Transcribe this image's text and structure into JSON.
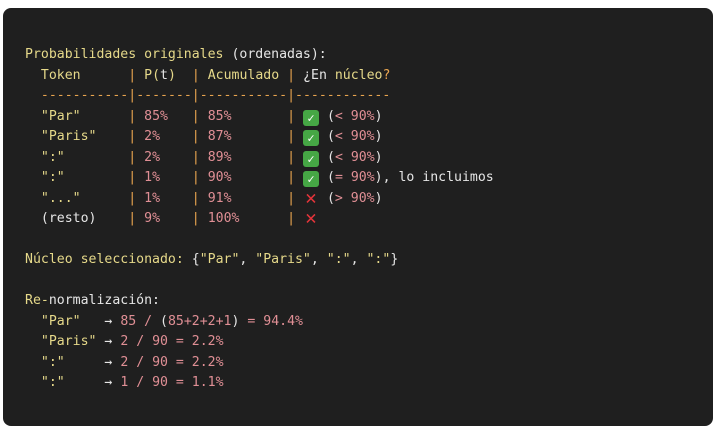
{
  "header": {
    "title": "Probabilidades originales",
    "qualifier": "(ordenadas):"
  },
  "table": {
    "columns": {
      "token": "Token",
      "p_prefix": "P(",
      "p_var": "t",
      "p_suffix": ")",
      "cumulative": "Acumulado",
      "nucleus_open": "¿En",
      "nucleus_word": "núcleo",
      "nucleus_q": "?"
    },
    "separator": {
      "c1": "-----------",
      "c2": "-------",
      "c3": "-----------",
      "c4": "------------"
    },
    "rows": [
      {
        "token": "\"Par\"",
        "p": "85%",
        "cum": "85%",
        "icon": "check-icon",
        "note_open": "(",
        "note_val": "< 90%",
        "note_close": ")",
        "note_extra": ""
      },
      {
        "token": "\"Paris\"",
        "p": "2%",
        "cum": "87%",
        "icon": "check-icon",
        "note_open": "(",
        "note_val": "< 90%",
        "note_close": ")",
        "note_extra": ""
      },
      {
        "token": "\":\"",
        "p": "2%",
        "cum": "89%",
        "icon": "check-icon",
        "note_open": "(",
        "note_val": "< 90%",
        "note_close": ")",
        "note_extra": ""
      },
      {
        "token": "\":\"",
        "p": "1%",
        "cum": "90%",
        "icon": "check-icon",
        "note_open": "(",
        "note_val": "= 90%",
        "note_close": ")",
        "note_extra": ", lo incluimos"
      },
      {
        "token": "\"...\"",
        "p": "1%",
        "cum": "91%",
        "icon": "cross-icon",
        "note_open": "(",
        "note_val": "> 90%",
        "note_close": ")",
        "note_extra": ""
      },
      {
        "token": "(resto)",
        "p": "9%",
        "cum": "100%",
        "icon": "cross-icon",
        "note_open": "",
        "note_val": "",
        "note_close": "",
        "note_extra": ""
      }
    ]
  },
  "nucleus": {
    "label": "Núcleo seleccionado:",
    "open": "{",
    "items": [
      "\"Par\"",
      "\"Paris\"",
      "\":\"",
      "\":\""
    ],
    "sep": ", ",
    "close": "}"
  },
  "renorm": {
    "prefix": "Re-",
    "label": "normalización:",
    "rows": [
      {
        "token": "\"Par\"",
        "arrow": "→",
        "expr_a": "85 / ",
        "open_paren": "(",
        "expr_b": "85+2+2+1",
        "close_paren": ")",
        "expr_c": " = 94.4%"
      },
      {
        "token": "\"Paris\"",
        "arrow": "→",
        "expr_a": "2 / 90 = 2.2%",
        "open_paren": "",
        "expr_b": "",
        "close_paren": "",
        "expr_c": ""
      },
      {
        "token": "\":\"",
        "arrow": "→",
        "expr_a": "2 / 90 = 2.2%",
        "open_paren": "",
        "expr_b": "",
        "close_paren": "",
        "expr_c": ""
      },
      {
        "token": "\":\"",
        "arrow": "→",
        "expr_a": "1 / 90 = 1.1%",
        "open_paren": "",
        "expr_b": "",
        "close_paren": "",
        "expr_c": ""
      }
    ]
  },
  "symbols": {
    "pipe": "|",
    "check": "✓",
    "cross": "✕"
  },
  "colors": {
    "background": "#1f1f1f",
    "keyword": "#e6d98a",
    "operator": "#e8a44f",
    "number": "#e08f95",
    "text": "#e6e6e6",
    "check": "#46a745",
    "cross": "#e3343a"
  }
}
